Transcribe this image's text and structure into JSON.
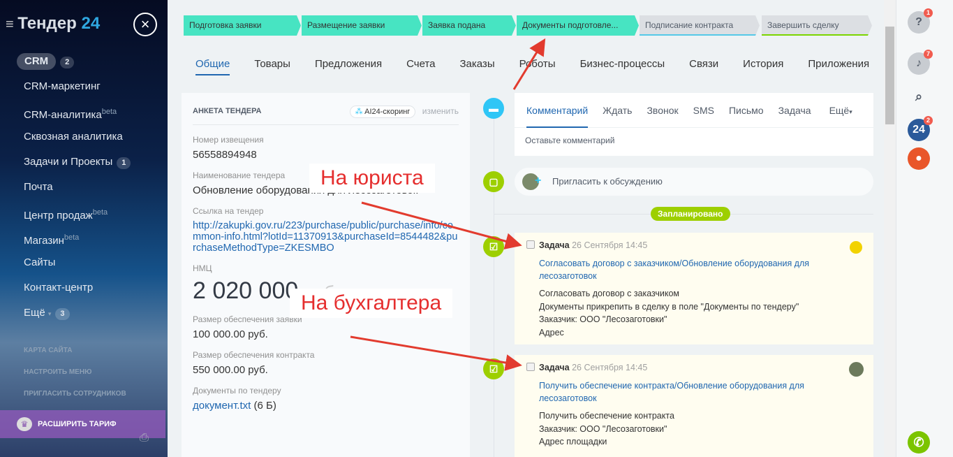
{
  "sidebar": {
    "logo_text": "Тендер",
    "logo_num": "24",
    "items": [
      {
        "label": "CRM",
        "badge": "2"
      },
      {
        "label": "CRM-маркетинг"
      },
      {
        "label": "CRM-аналитика",
        "sup": "beta"
      },
      {
        "label": "Сквозная аналитика"
      },
      {
        "label": "Задачи и Проекты",
        "badge": "1"
      },
      {
        "label": "Почта"
      },
      {
        "label": "Центр продаж",
        "sup": "beta"
      },
      {
        "label": "Магазин",
        "sup": "beta"
      },
      {
        "label": "Сайты"
      },
      {
        "label": "Контакт-центр"
      },
      {
        "label": "Ещё",
        "badge": "3"
      }
    ],
    "links": [
      "КАРТА САЙТА",
      "НАСТРОИТЬ МЕНЮ",
      "ПРИГЛАСИТЬ СОТРУДНИКОВ"
    ],
    "upgrade": "РАСШИРИТЬ ТАРИФ"
  },
  "stages": [
    "Подготовка заявки",
    "Размещение заявки",
    "Заявка подана",
    "Документы подготовле...",
    "Подписание контракта",
    "Завершить сделку"
  ],
  "tabs": [
    "Общие",
    "Товары",
    "Предложения",
    "Счета",
    "Заказы",
    "Роботы",
    "Бизнес-процессы",
    "Связи",
    "История",
    "Приложения"
  ],
  "card": {
    "title": "АНКЕТА ТЕНДЕРА",
    "scoring": "AI24-скоринг",
    "edit": "изменить",
    "fields": [
      {
        "label": "Номер извещения",
        "value": "56558894948"
      },
      {
        "label": "Наименование тендера",
        "value": "Обновление оборудования для лесозаготовок"
      },
      {
        "label": "Ссылка на тендер",
        "value": "http://zakupki.gov.ru/223/purchase/public/purchase/info/common-info.html?lotId=11370913&purchaseId=8544482&purchaseMethodType=ZKESMBO"
      },
      {
        "label": "НМЦ",
        "value": "2 020 000",
        "unit": "руб."
      },
      {
        "label": "Размер обеспечения заявки",
        "value": "100 000.00 руб."
      },
      {
        "label": "Размер обеспечения контракта",
        "value": "550 000.00 руб."
      },
      {
        "label": "Документы по тендеру",
        "value": "документ.txt",
        "size": "(6 Б)"
      }
    ]
  },
  "activity": {
    "tabs": [
      "Комментарий",
      "Ждать",
      "Звонок",
      "SMS",
      "Письмо",
      "Задача",
      "Ещё"
    ],
    "comment_placeholder": "Оставьте комментарий",
    "invite": "Пригласить к обсуждению",
    "planned": "Запланировано"
  },
  "tasks": [
    {
      "type": "Задача",
      "date": "26 Сентября 14:45",
      "title": "Согласовать договор с заказчиком/Обновление оборудования для лесозаготовок",
      "lines": [
        "Согласовать договор с заказчиком",
        "Документы прикрепить в сделку в поле \"Документы по тендеру\"",
        "Заказчик: ООО \"Лесозаготовки\"",
        "Адрес"
      ]
    },
    {
      "type": "Задача",
      "date": "26 Сентября 14:45",
      "title": "Получить обеспечение контракта/Обновление оборудования для лесозаготовок",
      "lines": [
        "Получить обеспечение контракта",
        "Заказчик: ООО \"Лесозаготовки\"",
        "Адрес площадки"
      ]
    }
  ],
  "annotations": [
    "На юриста",
    "На бухгалтера"
  ],
  "right_panel": {
    "help_badge": "1",
    "notif_badge": "7",
    "b24_label": "24",
    "b24_badge": "2"
  }
}
